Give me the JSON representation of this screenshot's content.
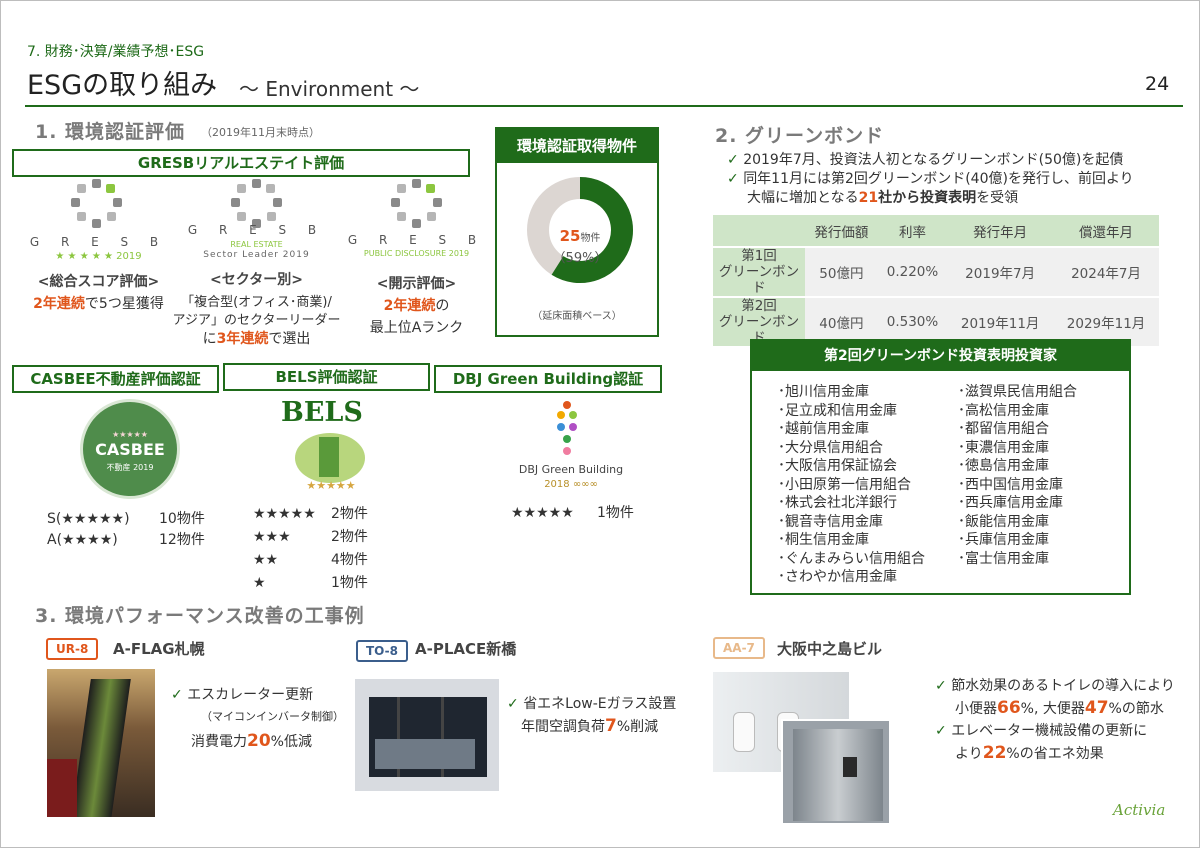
{
  "header": {
    "chapter": "7. 財務･決算/業績予想･ESG",
    "title": "ESGの取り組み",
    "subtitle": "～ Environment ～",
    "page_number": "24"
  },
  "section1": {
    "title": "1. 環境認証評価",
    "note": "（2019年11月末時点）",
    "gresb_header": "GRESBリアルエステイト評価",
    "gresb_items": [
      {
        "logo_text": "G R E S B",
        "logo_sub": "★ ★ ★ ★ ★ 2019",
        "heading": "<総合スコア評価>",
        "line1_highlight": "2年連続",
        "line1_rest": "で5つ星獲得"
      },
      {
        "logo_text": "G R E S B",
        "logo_sub1": "REAL ESTATE",
        "logo_sub2": "Sector Leader 2019",
        "heading": "<セクター別>",
        "line1": "「複合型(オフィス･商業)/",
        "line2": "アジア」のセクターリーダー",
        "line3_prefix": "に",
        "line3_highlight": "3年連続",
        "line3_rest": "で選出"
      },
      {
        "logo_text": "G R E S B",
        "logo_sub": "PUBLIC DISCLOSURE 2019",
        "heading": "<開示評価>",
        "line1_highlight": "2年連続",
        "line1_rest": "の",
        "line2": "最上位Aランク"
      }
    ],
    "cert_box": {
      "title": "環境認証取得物件",
      "count": "25",
      "unit": "物件",
      "percent": "（59%）",
      "note": "（延床面積ベース）",
      "share": 0.59
    },
    "casbee": {
      "header": "CASBEE不動産評価認証",
      "logo": "CASBEE",
      "logo_sub": "不動産 2019",
      "rows": [
        {
          "rank": "S(★★★★★)",
          "count": "10物件"
        },
        {
          "rank": "A(★★★★)",
          "count": "12物件"
        }
      ]
    },
    "bels": {
      "header": "BELS評価認証",
      "logo": "BELS",
      "rows": [
        {
          "stars": "★★★★★",
          "count": "2物件"
        },
        {
          "stars": "★★★",
          "count": "2物件"
        },
        {
          "stars": "★★",
          "count": "4物件"
        },
        {
          "stars": "★",
          "count": "1物件"
        }
      ]
    },
    "dbj": {
      "header": "DBJ Green Building認証",
      "logo_text": "DBJ Green Building",
      "logo_year": "2018",
      "rows": [
        {
          "stars": "★★★★★",
          "count": "1物件"
        }
      ]
    }
  },
  "section2": {
    "title": "2. グリーンボンド",
    "bullet1": "2019年7月、投資法人初となるグリーンボンド(50億)を起債",
    "bullet2_line1": "同年11月には第2回グリーンボンド(40億)を発行し、前回より",
    "bullet2_prefix": "大幅に増加となる",
    "bullet2_num": "21",
    "bullet2_bold": "社から投資表明",
    "bullet2_rest": "を受領",
    "table": {
      "columns": [
        "発行価額",
        "利率",
        "発行年月",
        "償還年月"
      ],
      "rows": [
        {
          "label1": "第1回",
          "label2": "グリーンボンド",
          "cells": [
            "50億円",
            "0.220%",
            "2019年7月",
            "2024年7月"
          ]
        },
        {
          "label1": "第2回",
          "label2": "グリーンボンド",
          "cells": [
            "40億円",
            "0.530%",
            "2019年11月",
            "2029年11月"
          ]
        }
      ]
    },
    "investors_header": "第2回グリーンボンド投資表明投資家",
    "investors_left": [
      "･旭川信用金庫",
      "･足立成和信用金庫",
      "･越前信用金庫",
      "･大分県信用組合",
      "･大阪信用保証協会",
      "･小田原第一信用組合",
      "･株式会社北洋銀行",
      "･観音寺信用金庫",
      "･桐生信用金庫",
      "･ぐんまみらい信用組合",
      "･さわやか信用金庫"
    ],
    "investors_right": [
      "･滋賀県民信用組合",
      "･高松信用金庫",
      "･都留信用組合",
      "･東濃信用金庫",
      "･徳島信用金庫",
      "･西中国信用金庫",
      "･西兵庫信用金庫",
      "･飯能信用金庫",
      "･兵庫信用金庫",
      "･富士信用金庫"
    ]
  },
  "section3": {
    "title": "3. 環境パフォーマンス改善の工事例",
    "cases": [
      {
        "tag": "UR-8",
        "tag_color": "#e0561c",
        "name": "A-FLAG札幌",
        "line1": "エスカレーター更新",
        "line2": "（マイコンインバータ制御）",
        "line3_prefix": "消費電力",
        "line3_num": "20",
        "line3_rest": "%低減"
      },
      {
        "tag": "TO-8",
        "tag_color": "#3b5e8c",
        "name": "A-PLACE新橋",
        "line1": "省エネLow-Eガラス設置",
        "line2_prefix": "年間空調負荷",
        "line2_num": "7",
        "line2_rest": "%削減"
      },
      {
        "tag": "AA-7",
        "tag_color": "#e8b98a",
        "name": "大阪中之島ビル",
        "b1_line1": "節水効果のあるトイレの導入により",
        "b1_prefix": "小便器",
        "b1_num1": "66",
        "b1_mid": "%, 大便器",
        "b1_num2": "47",
        "b1_rest": "%の節水",
        "b2_line1": "エレベーター機械設備の更新に",
        "b2_prefix": "より",
        "b2_num": "22",
        "b2_rest": "%の省エネ効果"
      }
    ]
  },
  "footer": {
    "logo": "Activia"
  },
  "colors": {
    "accent": "#1f6b1a",
    "highlight": "#e0561c",
    "light_green": "#cfe5c8"
  }
}
